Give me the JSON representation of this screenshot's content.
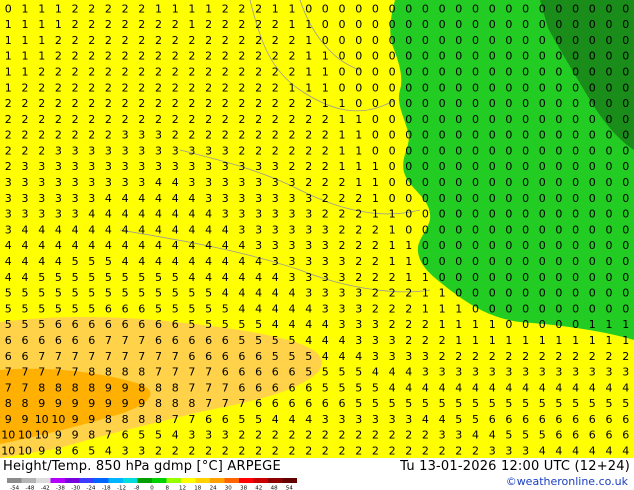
{
  "header": {
    "title_left": "Height/Temp. 850 hPa  gdmp [°C] ARPEGE",
    "title_right": "Tu 13-01-2026 12:00 UTC (12+24)"
  },
  "footer": {
    "credit": "©weatheronline.co.uk"
  },
  "legend": {
    "ticks": [
      "-54",
      "-48",
      "-42",
      "-38",
      "-30",
      "-24",
      "-18",
      "-12",
      "-8",
      "0",
      "8",
      "12",
      "18",
      "24",
      "30",
      "38",
      "42",
      "48",
      "54"
    ],
    "colors": [
      "#8c8c8c",
      "#b4b4b4",
      "#dcdcdc",
      "#b400ff",
      "#7800dc",
      "#3c3cff",
      "#0064ff",
      "#00b4ff",
      "#00dcdc",
      "#00a000",
      "#00d200",
      "#96ff00",
      "#ffff00",
      "#ffd200",
      "#ffa000",
      "#ff6400",
      "#ff0000",
      "#c80000",
      "#8c0000",
      "#640000"
    ]
  },
  "map": {
    "colors": {
      "green_dark": "#1a8c1a",
      "green": "#22cc22",
      "green_light": "#3cd83c",
      "yellow": "#ffff00",
      "yellow_pale": "#fff230",
      "orange_light": "#ffd24a",
      "orange": "#ffb000",
      "orange_deep": "#ff9a00",
      "contour": "#000000",
      "boundary": "#9a9a9a"
    },
    "rows": [
      "0 1 1 1 2 2 2 2 2 1 1 1 1 2 2 2 1 1 0 0 0 0 0 0 0 0 0 0 0 0 0 0 0 0 0 0 0 0",
      "1 1 1 1 2 2 2 2 2 2 2 1 2 2 2 2 2 1 1 0 0 0 0 0 0 0 0 0 0 0 0 0 0 0 0 0 0 0",
      "1 1 1 2 2 2 2 2 2 2 2 2 2 2 2 2 2 2 1 0 0 0 0 0 0 0 0 0 0 0 0 0 0 0 0 0 0 0",
      "1 1 1 2 2 2 2 2 2 2 2 2 2 2 2 2 2 2 1 1 0 0 0 0 0 0 0 0 0 0 0 0 0 0 0 0 0 0",
      "1 1 2 2 2 2 2 2 2 2 2 2 2 2 2 2 2 2 1 1 0 0 0 0 0 0 0 0 0 0 0 0 0 0 0 0 0 0",
      "1 2 2 2 2 2 2 2 2 2 2 2 2 2 2 2 2 1 1 1 0 0 0 0 0 0 0 0 0 0 0 0 0 0 0 0 0 0",
      "2 2 2 2 2 2 2 2 2 2 2 2 2 2 2 2 2 2 2 1 1 0 0 0 0 0 0 0 0 0 0 0 0 0 0 0 0 0",
      "2 2 2 2 2 2 2 2 2 2 2 2 2 2 2 2 2 2 2 2 1 1 0 0 0 0 0 0 0 0 0 0 0 0 0 0 0 0",
      "2 2 2 2 2 2 2 3 3 3 2 2 2 2 2 2 2 2 2 2 1 1 0 0 0 0 0 0 0 0 0 0 0 0 0 0 0 0",
      "2 2 2 3 3 3 3 3 3 3 3 3 3 3 2 2 2 2 2 2 1 1 0 0 0 0 0 0 0 0 0 0 0 0 0 0 0 0",
      "2 3 3 3 3 3 3 3 3 3 3 3 3 3 3 3 3 2 2 2 1 1 1 0 0 0 0 0 0 0 0 0 0 0 0 0 0 0",
      "3 3 3 3 3 3 3 3 3 4 4 3 3 3 3 3 3 3 2 2 2 1 1 0 0 0 0 0 0 0 0 0 0 0 0 0 0 0",
      "3 3 3 3 3 3 4 4 4 4 4 4 3 3 3 3 3 3 3 2 2 2 1 0 0 0 0 0 0 0 0 0 0 0 0 0 0 0",
      "3 3 3 3 3 4 4 4 4 4 4 4 4 3 3 3 3 3 3 2 2 2 1 1 0 0 0 0 0 0 0 0 0 0 0 0 0 0",
      "3 4 4 4 4 4 4 4 4 4 4 4 4 4 3 3 3 3 3 3 2 2 2 1 0 0 0 0 0 0 0 0 0 0 0 0 0 0",
      "4 4 4 4 4 4 4 4 4 4 4 4 4 4 4 3 3 3 3 3 2 2 2 1 1 0 0 0 0 0 0 0 0 0 0 0 0 0",
      "4 4 4 4 5 5 5 4 4 4 4 4 4 4 4 4 3 3 3 3 3 2 2 1 1 0 0 0 0 0 0 0 0 0 0 0 0 0",
      "4 4 5 5 5 5 5 5 5 5 5 4 4 4 4 4 4 3 3 3 3 2 2 2 1 1 0 0 0 0 0 0 0 0 0 0 0 0",
      "5 5 5 5 5 5 5 5 5 5 5 5 5 4 4 4 4 4 3 3 3 3 2 2 2 1 1 0 0 0 0 0 0 0 0 0 0 0",
      "5 5 5 5 5 5 6 6 6 5 5 5 5 5 4 4 4 4 4 3 3 3 2 2 2 1 1 1 0 0 0 0 0 0 0 0 0 0",
      "5 5 5 6 6 6 6 6 6 6 6 5 5 5 5 5 4 4 4 4 3 3 3 2 2 2 1 1 1 1 0 0 0 0 0 1 1 1",
      "6 6 6 6 6 6 7 7 7 6 6 6 6 6 5 5 5 5 4 4 4 3 3 3 2 2 2 1 1 1 1 1 1 1 1 1 1 1",
      "6 6 7 7 7 7 7 7 7 7 7 6 6 6 6 6 5 5 5 4 4 4 3 3 3 3 2 2 2 2 2 2 2 2 2 2 2 2",
      "7 7 7 7 7 8 8 8 8 7 7 7 7 6 6 6 6 6 5 5 5 5 4 4 4 3 3 3 3 3 3 3 3 3 3 3 3 3",
      "7 7 8 8 8 8 9 9 8 8 8 7 7 7 6 6 6 6 6 5 5 5 5 4 4 4 4 4 4 4 4 4 4 4 4 4 4 4",
      "8 8 9 9 9 9 9 9 9 8 8 8 7 7 7 6 6 6 6 6 6 5 5 5 5 5 5 5 5 5 5 5 5 5 5 5 5 5",
      "9 9 10 10 9 9 8 8 8 8 7 7 6 6 5 5 4 4 4 3 3 3 3 3 3 4 4 5 5 6 6 6 6 6 6 6 6 6",
      "10 10 10 9 9 8 7 6 5 5 4 3 3 3 2 2 2 2 2 2 2 2 2 2 2 2 3 3 4 4 5 5 5 6 6 6 6 6",
      "10 10 9 8 6 5 4 3 3 2 2 2 2 2 2 2 2 2 2 2 2 2 2 2 2 2 2 2 2 3 3 3 4 4 4 4 4 4"
    ]
  }
}
